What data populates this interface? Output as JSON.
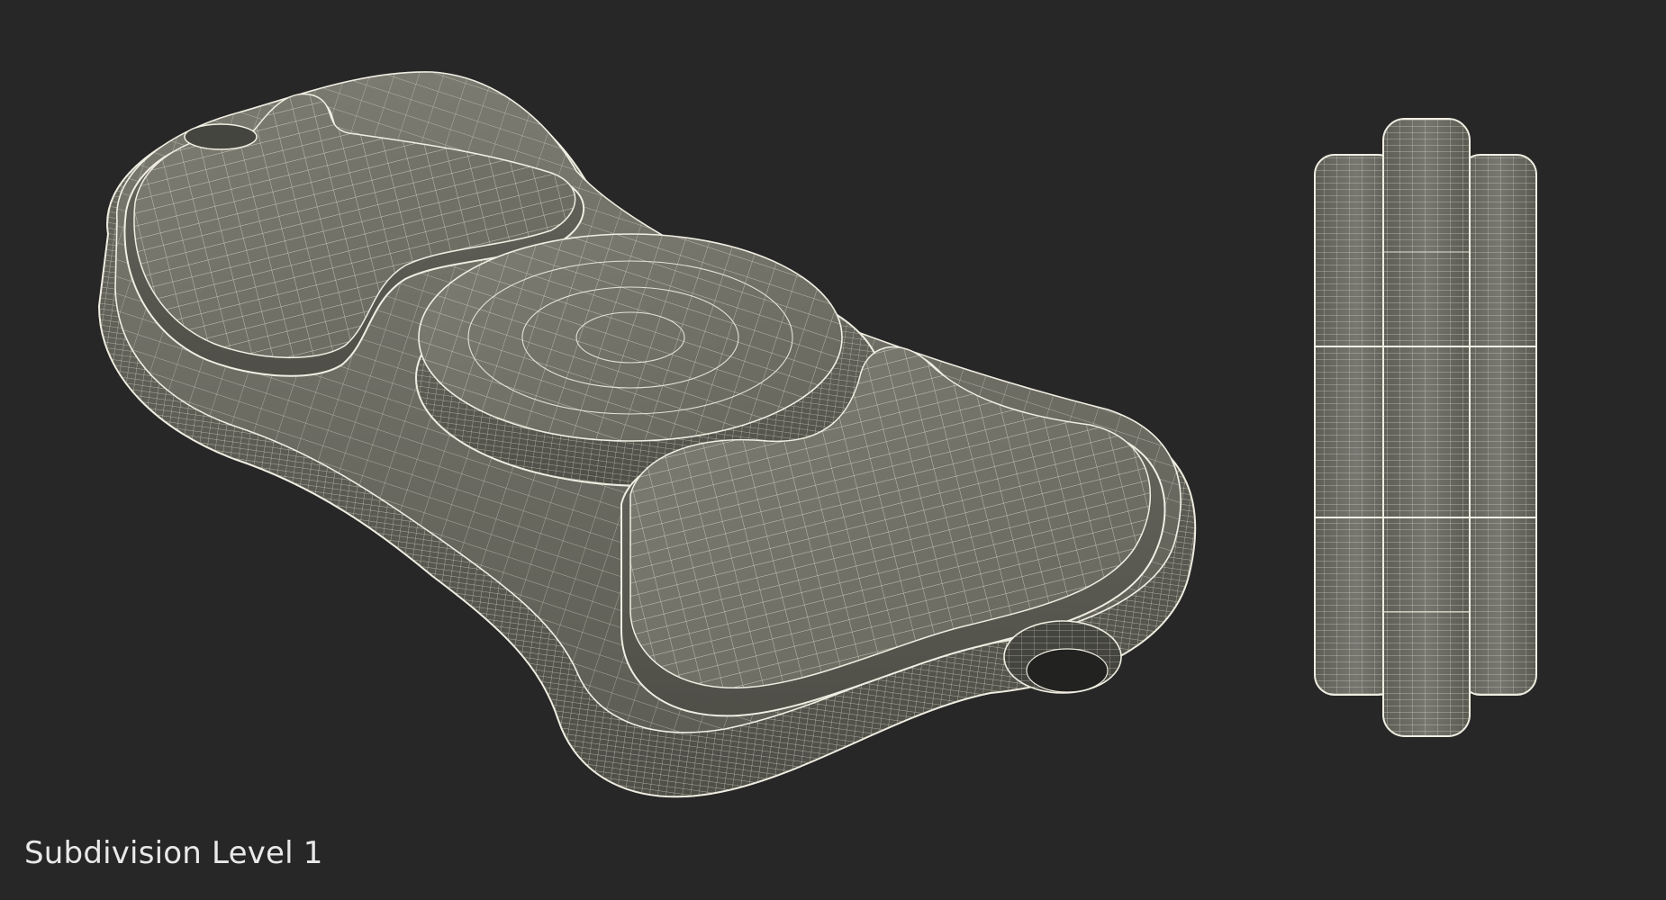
{
  "caption": {
    "text": "Subdivision Level 1"
  },
  "scene": {
    "background_color": "#272727",
    "mesh_fill_color": "#6f6f66",
    "mesh_shadow_color": "#57574f",
    "wire_color": "#e4e2d4"
  }
}
